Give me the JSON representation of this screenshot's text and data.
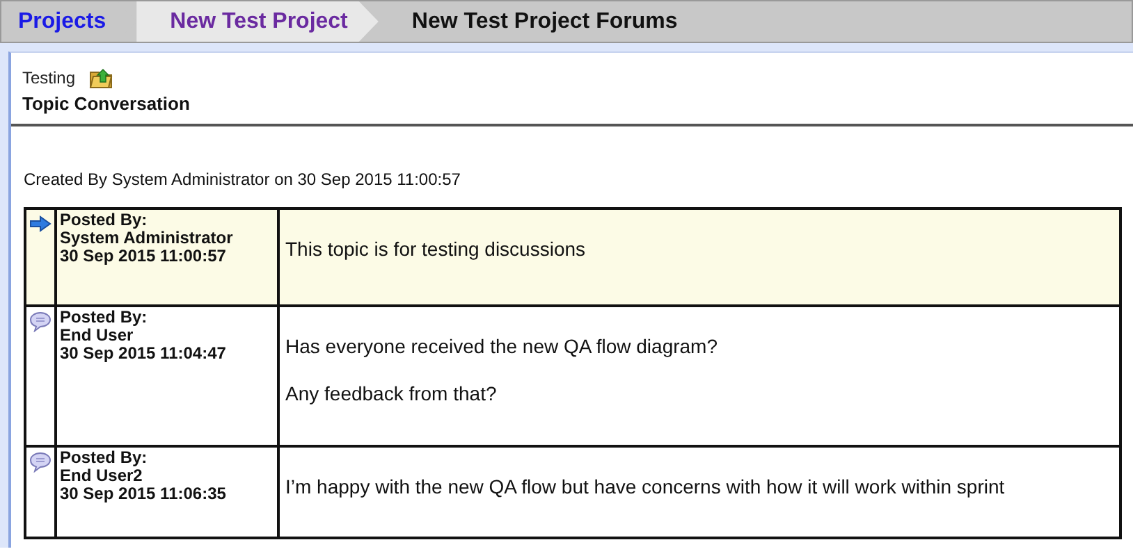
{
  "breadcrumbs": [
    {
      "label": "Projects",
      "kind": "root"
    },
    {
      "label": "New Test Project",
      "kind": "visited"
    },
    {
      "label": "New Test Project Forums",
      "kind": "current"
    }
  ],
  "forum": {
    "name": "Testing",
    "title": "Topic Conversation"
  },
  "created_by": "Created By System Administrator on 30 Sep 2015 11:00:57",
  "posts": [
    {
      "kind": "topic",
      "label": "Posted By:",
      "author": "System Administrator",
      "date": "30 Sep 2015 11:00:57",
      "message": [
        "This topic is for testing discussions"
      ]
    },
    {
      "kind": "reply",
      "label": "Posted By:",
      "author": "End User",
      "date": "30 Sep 2015 11:04:47",
      "message": [
        "Has everyone received the new QA flow diagram?",
        "Any feedback from that?"
      ]
    },
    {
      "kind": "reply",
      "label": "Posted By:",
      "author": "End User2",
      "date": "30 Sep 2015 11:06:35",
      "message": [
        "I’m happy with the new QA flow but have concerns with how it will work within sprint"
      ]
    }
  ]
}
